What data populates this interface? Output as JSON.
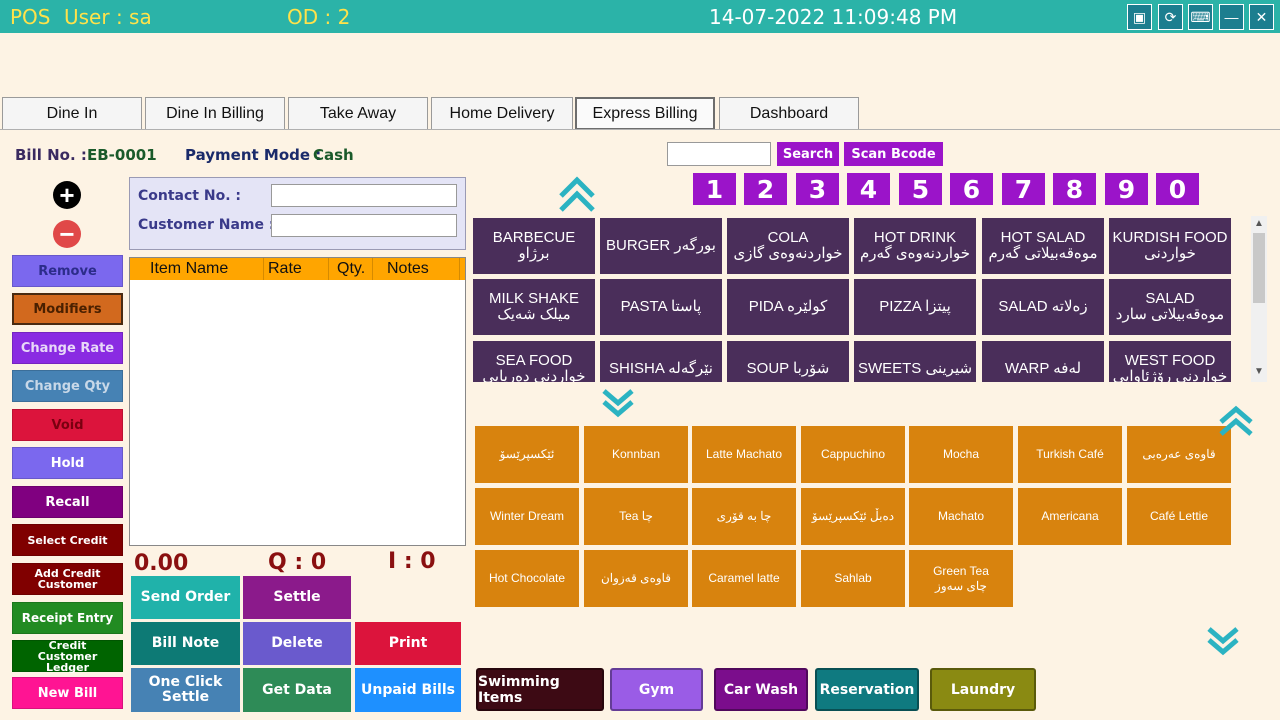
{
  "titlebar": {
    "pos": "POS",
    "user": "User : sa",
    "od": "OD : 2",
    "datetime": "14-07-2022 11:09:48 PM"
  },
  "tabs": [
    "Dine In",
    "Dine In Billing",
    "Take Away",
    "Home Delivery",
    "Express Billing",
    "Dashboard"
  ],
  "bill": {
    "bill_no_label": "Bill No. :",
    "bill_no": "EB-0001",
    "payment_mode_label": "Payment Mode :",
    "payment_mode": "Cash"
  },
  "search": {
    "search_label": "Search",
    "scan_label": "Scan Bcode"
  },
  "numbers": [
    "1",
    "2",
    "3",
    "4",
    "5",
    "6",
    "7",
    "8",
    "9",
    "0"
  ],
  "customer": {
    "contact_label": "Contact No. :",
    "name_label": "Customer Name :"
  },
  "grid_headers": [
    "Item Name",
    "Rate",
    "Qty.",
    "Notes"
  ],
  "left_buttons": [
    {
      "label": "Remove",
      "color": "#7b68ee"
    },
    {
      "label": "Modifiers",
      "color": "#d2691e"
    },
    {
      "label": "Change Rate",
      "color": "#8a2be2"
    },
    {
      "label": "Change Qty",
      "color": "#4682b4"
    },
    {
      "label": "Void",
      "color": "#dc143c"
    },
    {
      "label": "Hold",
      "color": "#7b68ee"
    },
    {
      "label": "Recall",
      "color": "#800080"
    },
    {
      "label": "Select Credit",
      "color": "#800000"
    },
    {
      "label": "Add Credit Customer",
      "color": "#800000"
    },
    {
      "label": "Receipt Entry",
      "color": "#228b22"
    },
    {
      "label": "Credit Customer Ledger",
      "color": "#006400"
    },
    {
      "label": "New Bill",
      "color": "#ff1493"
    }
  ],
  "totals": {
    "amount": "0.00",
    "q": "Q : 0",
    "i": "I : 0"
  },
  "action_buttons": {
    "send_order": "Send Order",
    "settle": "Settle",
    "bill_note": "Bill Note",
    "delete": "Delete",
    "print": "Print",
    "one_click_settle": "One Click Settle",
    "get_data": "Get Data",
    "unpaid_bills": "Unpaid Bills"
  },
  "categories": [
    "BARBECUE برژاو",
    "BURGER بورگەر",
    "COLA خواردنەوەی گازی",
    "HOT DRINK خواردنەوەی گەرم",
    "HOT SALAD موەقەبیلاتی گەرم",
    "KURDISH FOOD خواردنی",
    "MILK SHAKE میلک شەیک",
    "PASTA پاستا",
    "PIDA کولێرە",
    "PIZZA پیتزا",
    "SALAD زەلاتە",
    "SALAD موەقەبیلاتی سارد",
    "SEA FOOD خواردنی دەریایی",
    "SHISHA نێرگەلە",
    "SOUP شۆربا",
    "SWEETS شیرینی",
    "WARP لەفە",
    "WEST FOOD خواردنی رۆژئاوایی"
  ],
  "items": [
    "ئێکسپرێسۆ",
    "Konnban",
    "Latte Machato",
    "Cappuchino",
    "Mocha",
    "Turkish Café",
    "قاوەی عەرەبی",
    "Winter Dream",
    "Tea چا",
    "چا بە قۆری",
    "دەبڵ ئێکسپرێسۆ",
    "Machato",
    "Americana",
    "Café Lettie",
    "Hot Chocolate",
    "قاوەی قەزوان",
    "Caramel latte",
    "Sahlab",
    "Green Tea چای سەوز"
  ],
  "bottom_buttons": [
    {
      "label": "Swimming Items",
      "color": "#3d0a14"
    },
    {
      "label": "Gym",
      "color": "#9a5ce6"
    },
    {
      "label": "Car Wash",
      "color": "#7b0d8c"
    },
    {
      "label": "Reservation",
      "color": "#0f7a80"
    },
    {
      "label": "Laundry",
      "color": "#8a8a12"
    }
  ],
  "colors": {
    "titlebar": "#2bb3a8",
    "background": "#fdf3e4",
    "category": "#4a2e5a",
    "item": "#d8830e",
    "accent_purple": "#9b14c9"
  }
}
